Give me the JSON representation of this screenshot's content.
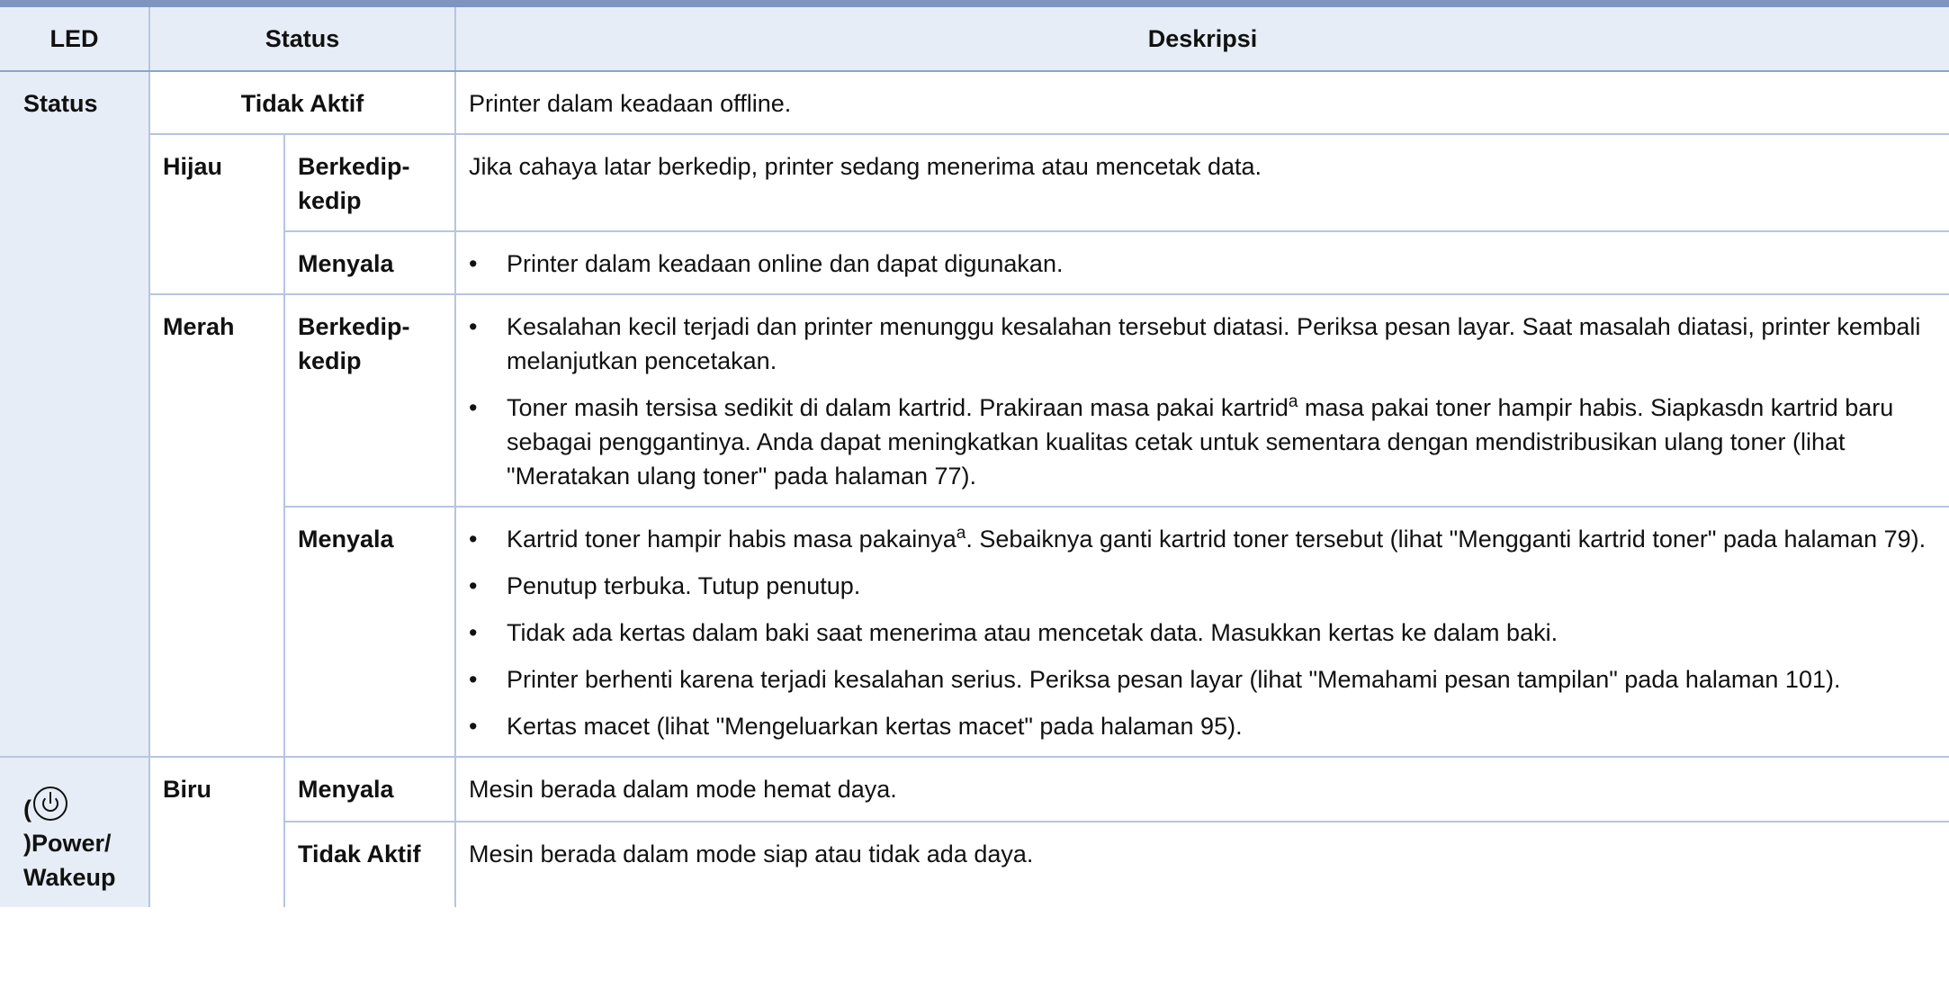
{
  "table": {
    "headers": {
      "led": "LED",
      "status": "Status",
      "description": "Deskripsi"
    },
    "status_led": {
      "label": "Status",
      "off": {
        "state": "Tidak Aktif",
        "desc": "Printer dalam keadaan offline."
      },
      "green": {
        "color": "Hijau",
        "blinking": {
          "state": "Berkedip-kedip",
          "desc": "Jika cahaya latar berkedip, printer sedang menerima atau mencetak data."
        },
        "on": {
          "state": "Menyala",
          "bullets": [
            "Printer dalam keadaan online dan dapat digunakan."
          ]
        }
      },
      "red": {
        "color": "Merah",
        "blinking": {
          "state": "Berkedip-kedip",
          "bullet1": "Kesalahan kecil terjadi dan printer menunggu kesalahan tersebut diatasi. Periksa pesan layar. Saat masalah diatasi, printer kembali melanjutkan pencetakan.",
          "bullet2_before": "Toner masih tersisa sedikit di dalam kartrid. Prakiraan masa pakai kartrid",
          "bullet2_sup": "a",
          "bullet2_after": " masa pakai toner hampir habis. Siapkasdn kartrid baru sebagai penggantinya. Anda dapat meningkatkan kualitas cetak untuk sementara dengan mendistribusikan ulang toner (lihat \"Meratakan ulang toner\" pada halaman 77)."
        },
        "on": {
          "state": "Menyala",
          "bullet1_before": "Kartrid toner hampir habis masa pakainya",
          "bullet1_sup": "a",
          "bullet1_after": ". Sebaiknya ganti kartrid toner tersebut (lihat \"Mengganti kartrid toner\" pada halaman 79).",
          "bullet2": "Penutup terbuka. Tutup penutup.",
          "bullet3": "Tidak ada kertas dalam baki saat menerima atau mencetak data. Masukkan kertas ke dalam baki.",
          "bullet4": "Printer berhenti karena terjadi kesalahan serius. Periksa pesan layar (lihat \"Memahami pesan tampilan\" pada halaman 101).",
          "bullet5": "Kertas macet (lihat \"Mengeluarkan kertas macet\" pada halaman 95)."
        }
      }
    },
    "power_led": {
      "label_open": "(",
      "icon": "power-icon",
      "label_rest": ")Power/ Wakeup",
      "color": "Biru",
      "on": {
        "state": "Menyala",
        "desc": "Mesin berada dalam mode hemat daya."
      },
      "off": {
        "state": "Tidak Aktif",
        "desc": "Mesin berada dalam mode siap atau tidak ada daya."
      }
    }
  }
}
